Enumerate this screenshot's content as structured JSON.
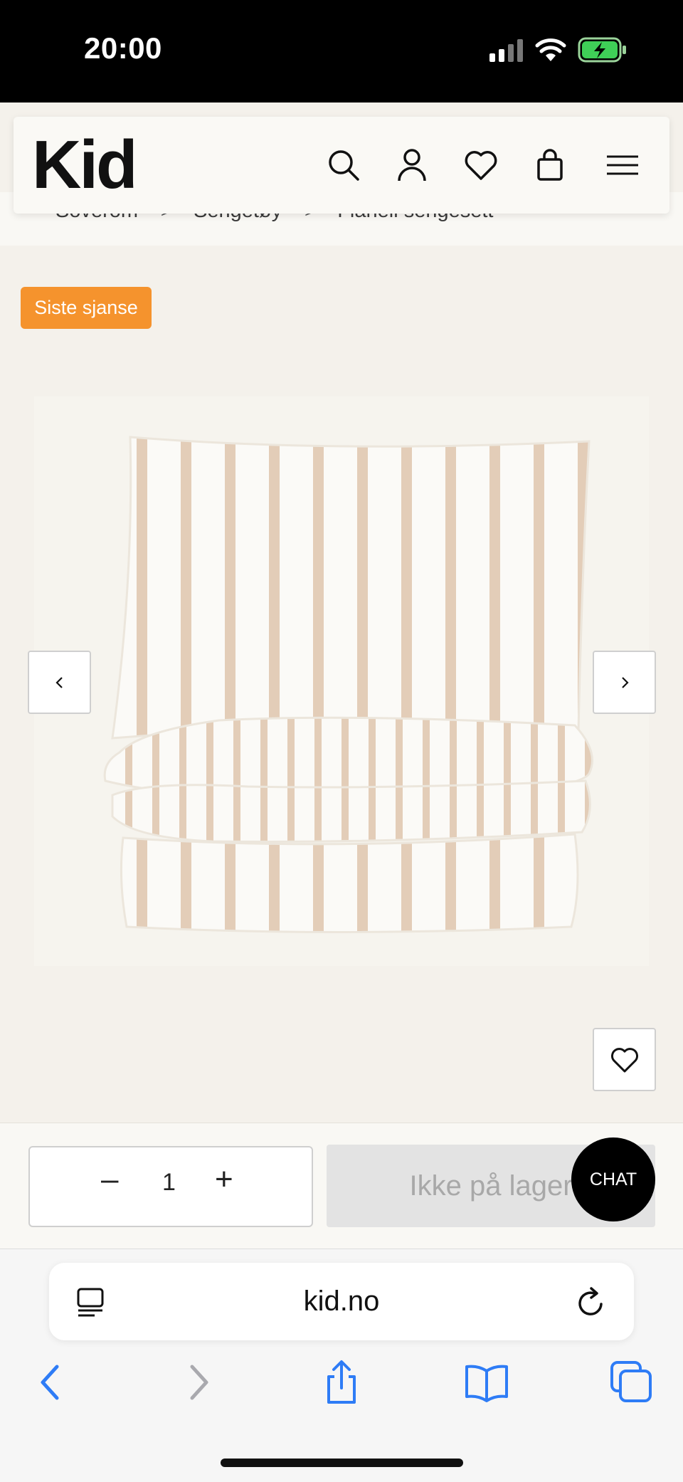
{
  "status_bar": {
    "time": "20:00",
    "icons": [
      "signal-icon",
      "wifi-icon",
      "battery-charging-icon"
    ]
  },
  "header": {
    "logo": "Kid",
    "icons": [
      "search-icon",
      "account-icon",
      "heart-icon",
      "bag-icon",
      "menu-icon"
    ]
  },
  "breadcrumb": {
    "items": [
      "Soverom",
      "Sengetøy",
      "Flanell sengesett"
    ],
    "separator": ">"
  },
  "product": {
    "badge": "Siste sjanse",
    "image_alt": "Striped flannel bedding set",
    "stripe_color": "#e3cdb8",
    "icons": [
      "chevron-left-icon",
      "chevron-right-icon",
      "heart-icon"
    ]
  },
  "purchase": {
    "quantity": "1",
    "minus": "–",
    "plus": "+",
    "cart_label": "Ikke på lager",
    "chat_label": "CHAT"
  },
  "browser": {
    "url": "kid.no",
    "icons": [
      "tab-overview-icon",
      "reload-icon",
      "back-icon",
      "forward-icon",
      "share-icon",
      "bookmarks-icon",
      "tabs-icon"
    ]
  },
  "colors": {
    "accent_orange": "#f5932d",
    "background": "#f4f1eb",
    "ios_blue": "#2e7cf6"
  }
}
